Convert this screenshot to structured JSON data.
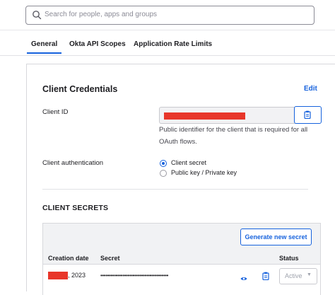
{
  "search": {
    "placeholder": "Search for people, apps and groups",
    "icon": "search-icon"
  },
  "tabs": [
    {
      "label": "General",
      "active": true
    },
    {
      "label": "Okta API Scopes",
      "active": false
    },
    {
      "label": "Application Rate Limits",
      "active": false
    }
  ],
  "credentials": {
    "title": "Client Credentials",
    "edit_label": "Edit",
    "client_id_label": "Client ID",
    "client_id_value": "",
    "client_id_help": "Public identifier for the client that is required for all OAuth flows.",
    "auth_label": "Client authentication",
    "auth_options": [
      {
        "label": "Client secret",
        "selected": true
      },
      {
        "label": "Public key / Private key",
        "selected": false
      }
    ]
  },
  "secrets": {
    "title": "CLIENT SECRETS",
    "generate_label": "Generate new secret",
    "columns": [
      "Creation date",
      "Secret",
      "Status"
    ],
    "rows": [
      {
        "creation_date": ", 2023",
        "secret": "••••••••••••••••••••••••••••••••••••••••",
        "status": "Active"
      }
    ]
  },
  "colors": {
    "accent": "#1662dd",
    "redaction": "#e8362a"
  }
}
